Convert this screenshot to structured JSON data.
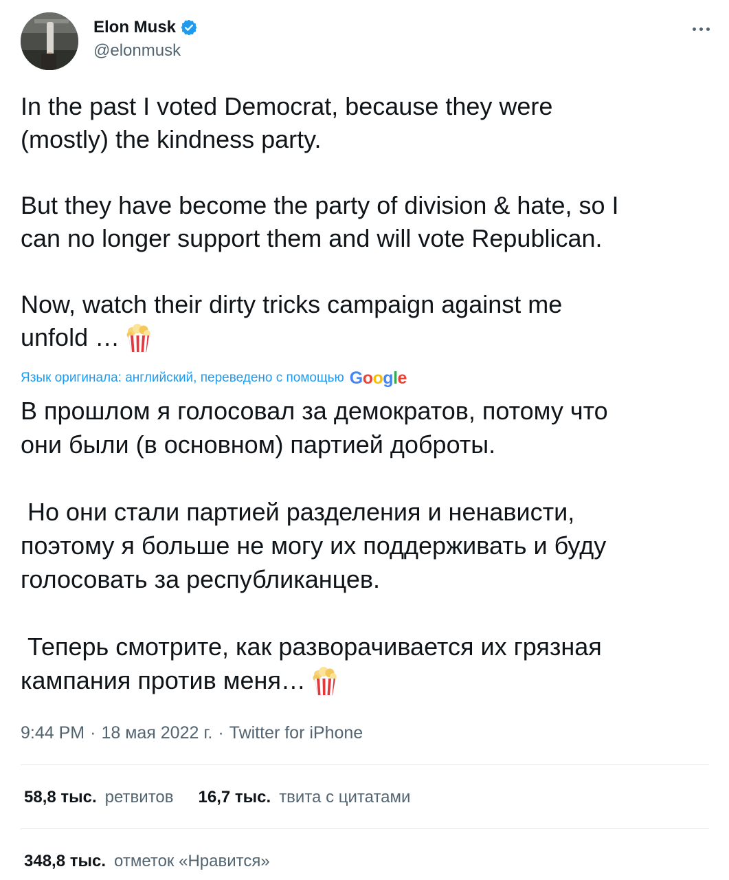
{
  "author": {
    "name": "Elon Musk",
    "handle": "@elonmusk",
    "verified_color": "#1d9bf0"
  },
  "tweet": {
    "original_text": "In the past I voted Democrat, because they were\n(mostly) the kindness party.\n\nBut they have become the party of division & hate, so I\ncan no longer support them and will vote Republican.\n\nNow, watch their dirty tricks campaign against me\nunfold …",
    "translation_note": "Язык оригинала: английский, переведено с помощью",
    "translation_provider": "Google",
    "translated_text": "В прошлом я голосовал за демократов, потому что\nони были (в основном) партией доброты.\n\n Но они стали партией разделения и ненависти,\nпоэтому я больше не могу их поддерживать и буду\nголосовать за республиканцев.\n\n Теперь смотрите, как разворачивается их грязная\nкампания против меня…",
    "emoji": "popcorn"
  },
  "meta": {
    "time": "9:44 PM",
    "date": "18 мая 2022 г.",
    "source": "Twitter for iPhone",
    "separator": "·"
  },
  "stats": {
    "retweets_count": "58,8 тыс.",
    "retweets_label": "ретвитов",
    "quotes_count": "16,7 тыс.",
    "quotes_label": "твита с цитатами",
    "likes_count": "348,8 тыс.",
    "likes_label": "отметок «Нравится»"
  },
  "colors": {
    "link_blue": "#1d9bf0",
    "text_primary": "#0f1419",
    "text_secondary": "#536471"
  },
  "icons": {
    "verified": "verified-badge-icon",
    "more": "more-options-icon",
    "popcorn": "popcorn-emoji"
  }
}
